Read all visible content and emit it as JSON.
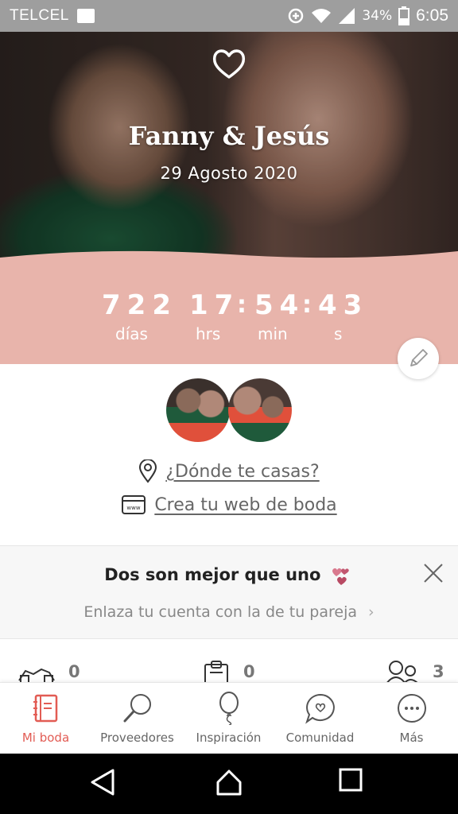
{
  "status_bar": {
    "carrier": "TELCEL",
    "battery": "34%",
    "time": "6:05"
  },
  "hero": {
    "names": "Fanny & Jesús",
    "date": "29 Agosto 2020"
  },
  "countdown": {
    "days": "722",
    "hours": "17",
    "minutes": "54",
    "seconds": "43",
    "days_label": "días",
    "hours_label": "hrs",
    "minutes_label": "min",
    "seconds_label": "s"
  },
  "links": {
    "location": "¿Dónde te casas?",
    "web": "Crea tu web de boda"
  },
  "partner_card": {
    "title": "Dos son mejor que uno",
    "subtitle": "Enlaza tu cuenta con la de tu pareja"
  },
  "stats": [
    {
      "value": "0"
    },
    {
      "value": "0"
    },
    {
      "value": "3"
    }
  ],
  "tabs": [
    {
      "label": "Mi boda",
      "icon": "notebook-icon",
      "active": true
    },
    {
      "label": "Proveedores",
      "icon": "search-icon"
    },
    {
      "label": "Inspiración",
      "icon": "balloon-icon"
    },
    {
      "label": "Comunidad",
      "icon": "chat-heart-icon"
    },
    {
      "label": "Más",
      "icon": "more-icon"
    }
  ],
  "colors": {
    "accent": "#e25c54",
    "countdown_bg": "#e8b4ab",
    "status_bar": "#9e9e9e"
  }
}
